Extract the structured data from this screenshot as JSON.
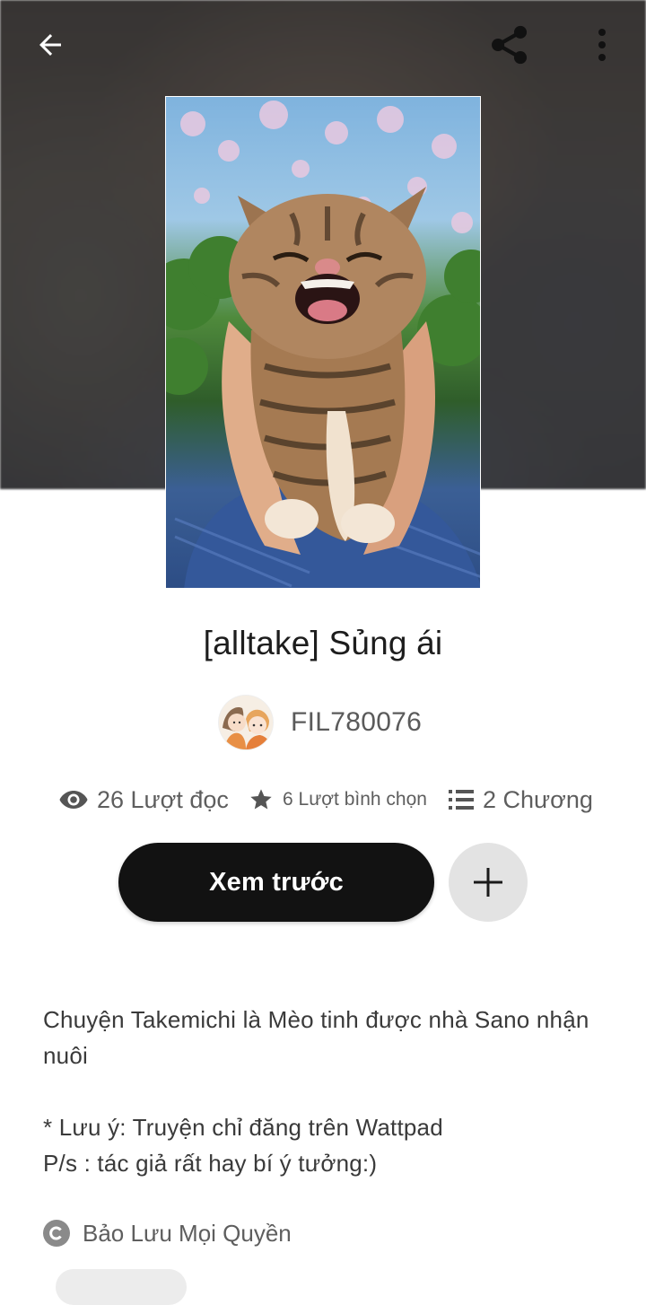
{
  "story": {
    "title": "[alltake] Sủng ái",
    "author": "FIL780076"
  },
  "stats": {
    "reads": "26 Lượt đọc",
    "votes": "6 Lượt bình chọn",
    "parts": "2 Chương"
  },
  "actions": {
    "preview_label": "Xem trước"
  },
  "description": {
    "line1": "Chuyện Takemichi là Mèo tinh được nhà Sano nhận nuôi",
    "line2": "* Lưu ý: Truyện chỉ đăng trên Wattpad",
    "line3": "P/s : tác giả rất hay bí ý tưởng:)"
  },
  "copyright": {
    "label": "Bảo Lưu Mọi Quyền"
  },
  "icons": {
    "back": "arrow-left-icon",
    "share": "share-icon",
    "more": "more-vertical-icon",
    "reads": "eye-icon",
    "votes": "star-icon",
    "parts": "list-icon",
    "add": "plus-icon",
    "copyright": "copyright-icon"
  },
  "colors": {
    "primary_button": "#121212",
    "secondary_button": "#e3e3e3",
    "text_muted": "#5e5e5e"
  }
}
